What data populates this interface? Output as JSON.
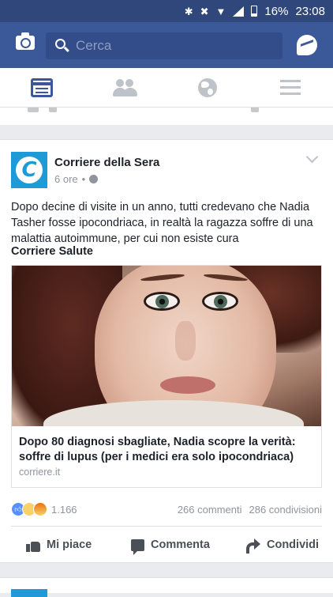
{
  "status_bar": {
    "battery": "16%",
    "time": "23:08"
  },
  "header": {
    "search_placeholder": "Cerca"
  },
  "nav": {
    "items": [
      {
        "name": "news-feed",
        "active": true
      },
      {
        "name": "friend-requests",
        "active": false
      },
      {
        "name": "notifications",
        "active": false
      },
      {
        "name": "menu",
        "active": false
      }
    ]
  },
  "post": {
    "page_name": "Corriere della Sera",
    "time": "6 ore",
    "separator": "•",
    "privacy_icon": "globe-icon",
    "text": "Dopo decine di visite in un anno, tutti credevano che Nadia Tasher fosse ipocondriaca, in realtà la ragazza soffre di una malattia autoimmune, per cui non esiste cura",
    "source": "Corriere Salute",
    "link": {
      "title": "Dopo 80 diagnosi sbagliate, Nadia scopre la verità: soffre di lupus (per i medici era solo ipocondriaca)",
      "domain": "corriere.it"
    },
    "reactions": {
      "types": [
        "like",
        "sad",
        "angry"
      ],
      "count": "1.166"
    },
    "comments": "266 commenti",
    "shares": "286 condivisioni",
    "actions": {
      "like": "Mi piace",
      "comment": "Commenta",
      "share": "Condividi"
    }
  },
  "colors": {
    "brand": "#3b5998",
    "status_bar": "#2f477a",
    "feed_bg": "#e9ebee",
    "avatar_bg": "#1e9ad6"
  }
}
